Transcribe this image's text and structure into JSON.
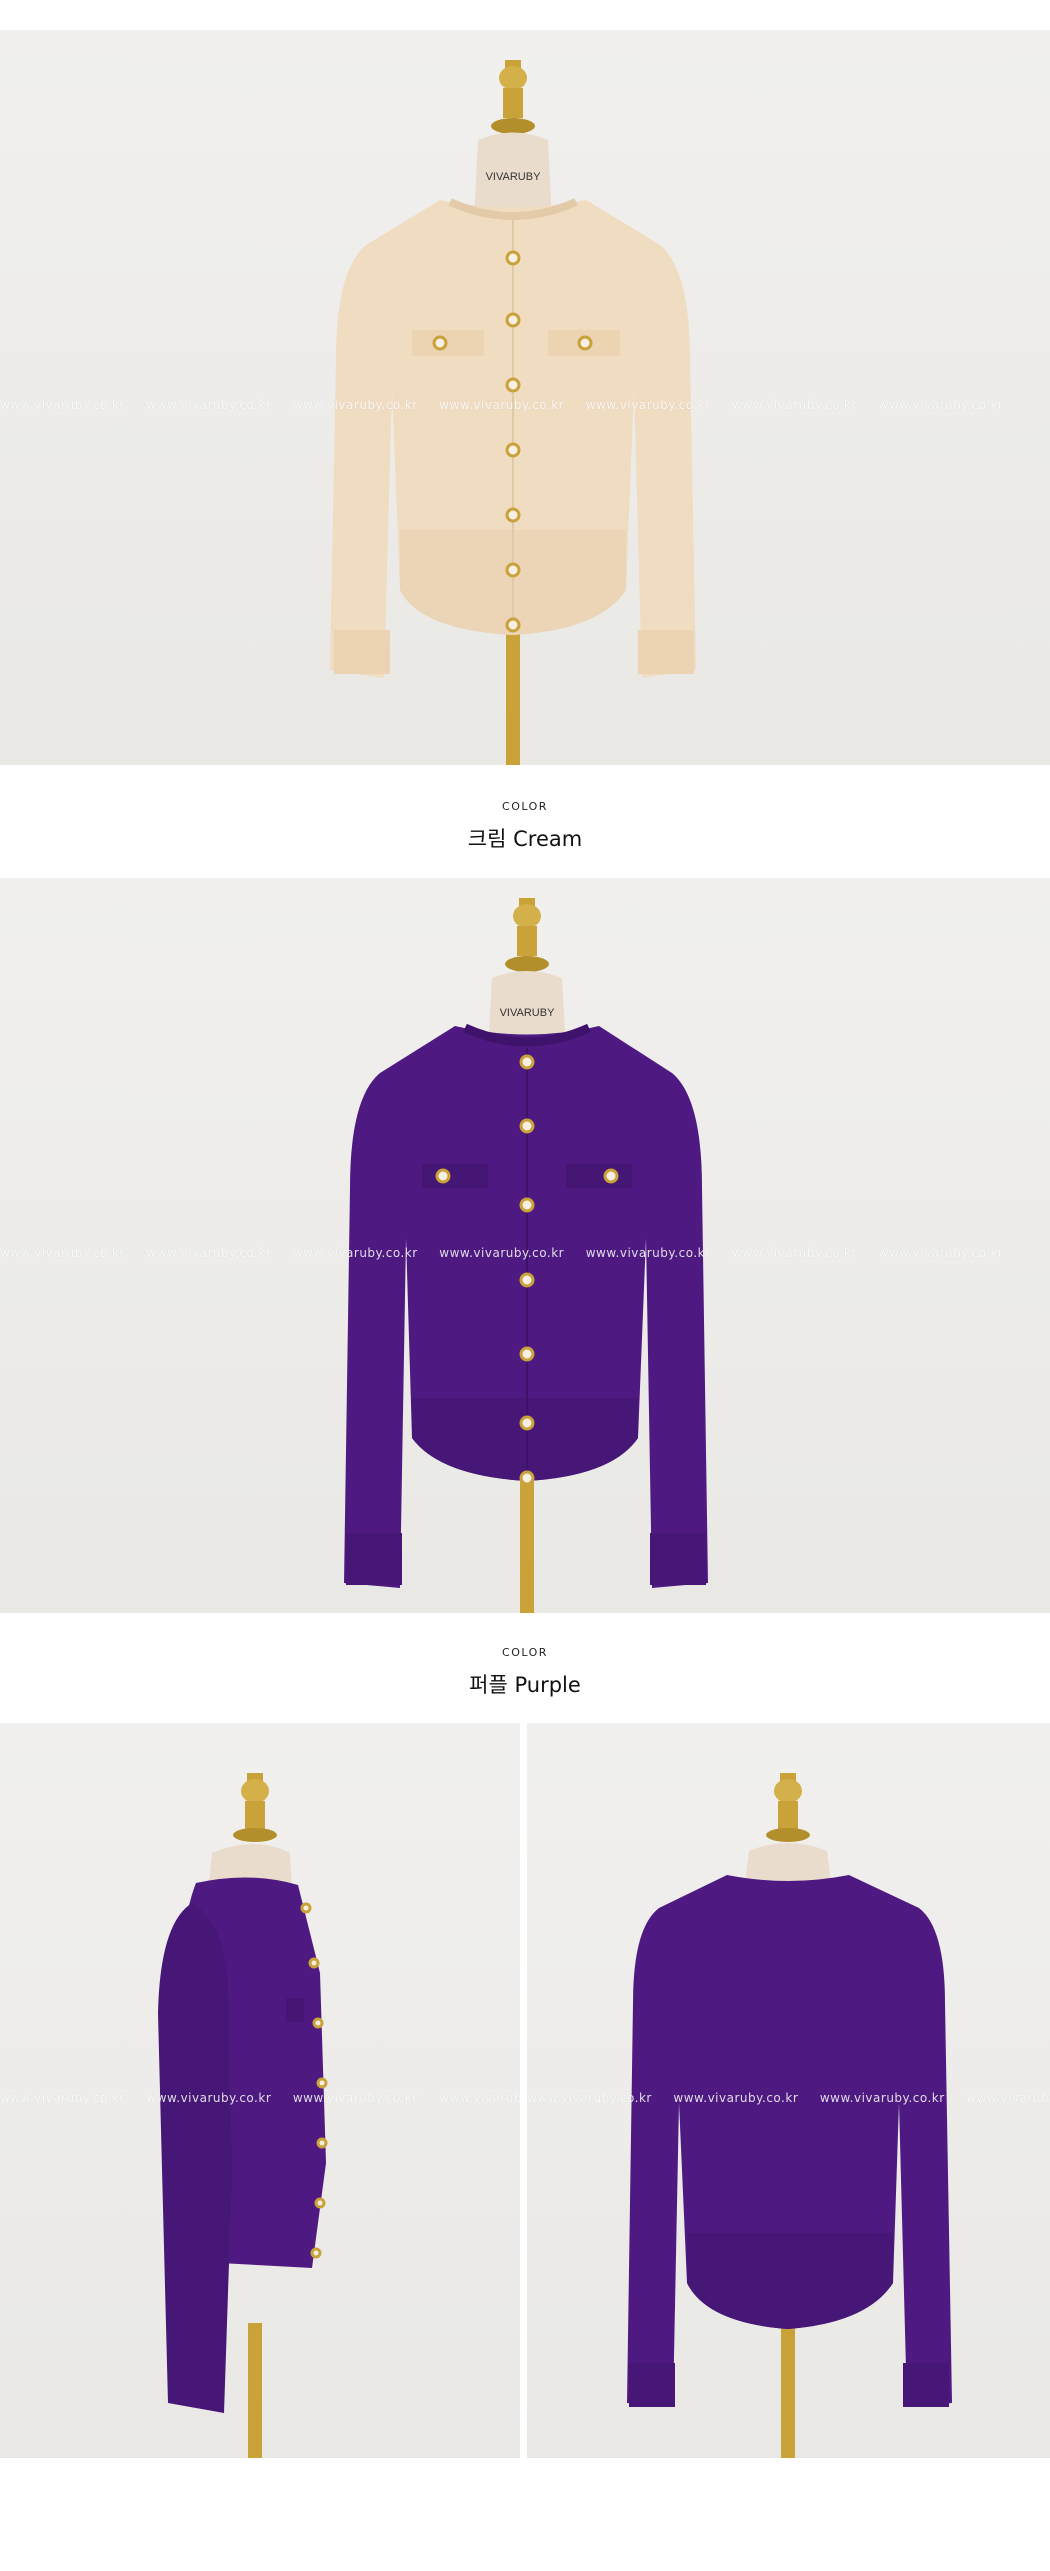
{
  "brand_tag": "VIVARUBY",
  "watermark": "www.vivaruby.co.kr",
  "colors": {
    "cream": "#f0dcc1",
    "purple": "#4e1a82",
    "brass": "#c9a23a",
    "background": "#ebeae7"
  },
  "sections": [
    {
      "label": "COLOR",
      "name": "크림 Cream"
    },
    {
      "label": "COLOR",
      "name": "퍼플 Purple"
    }
  ]
}
